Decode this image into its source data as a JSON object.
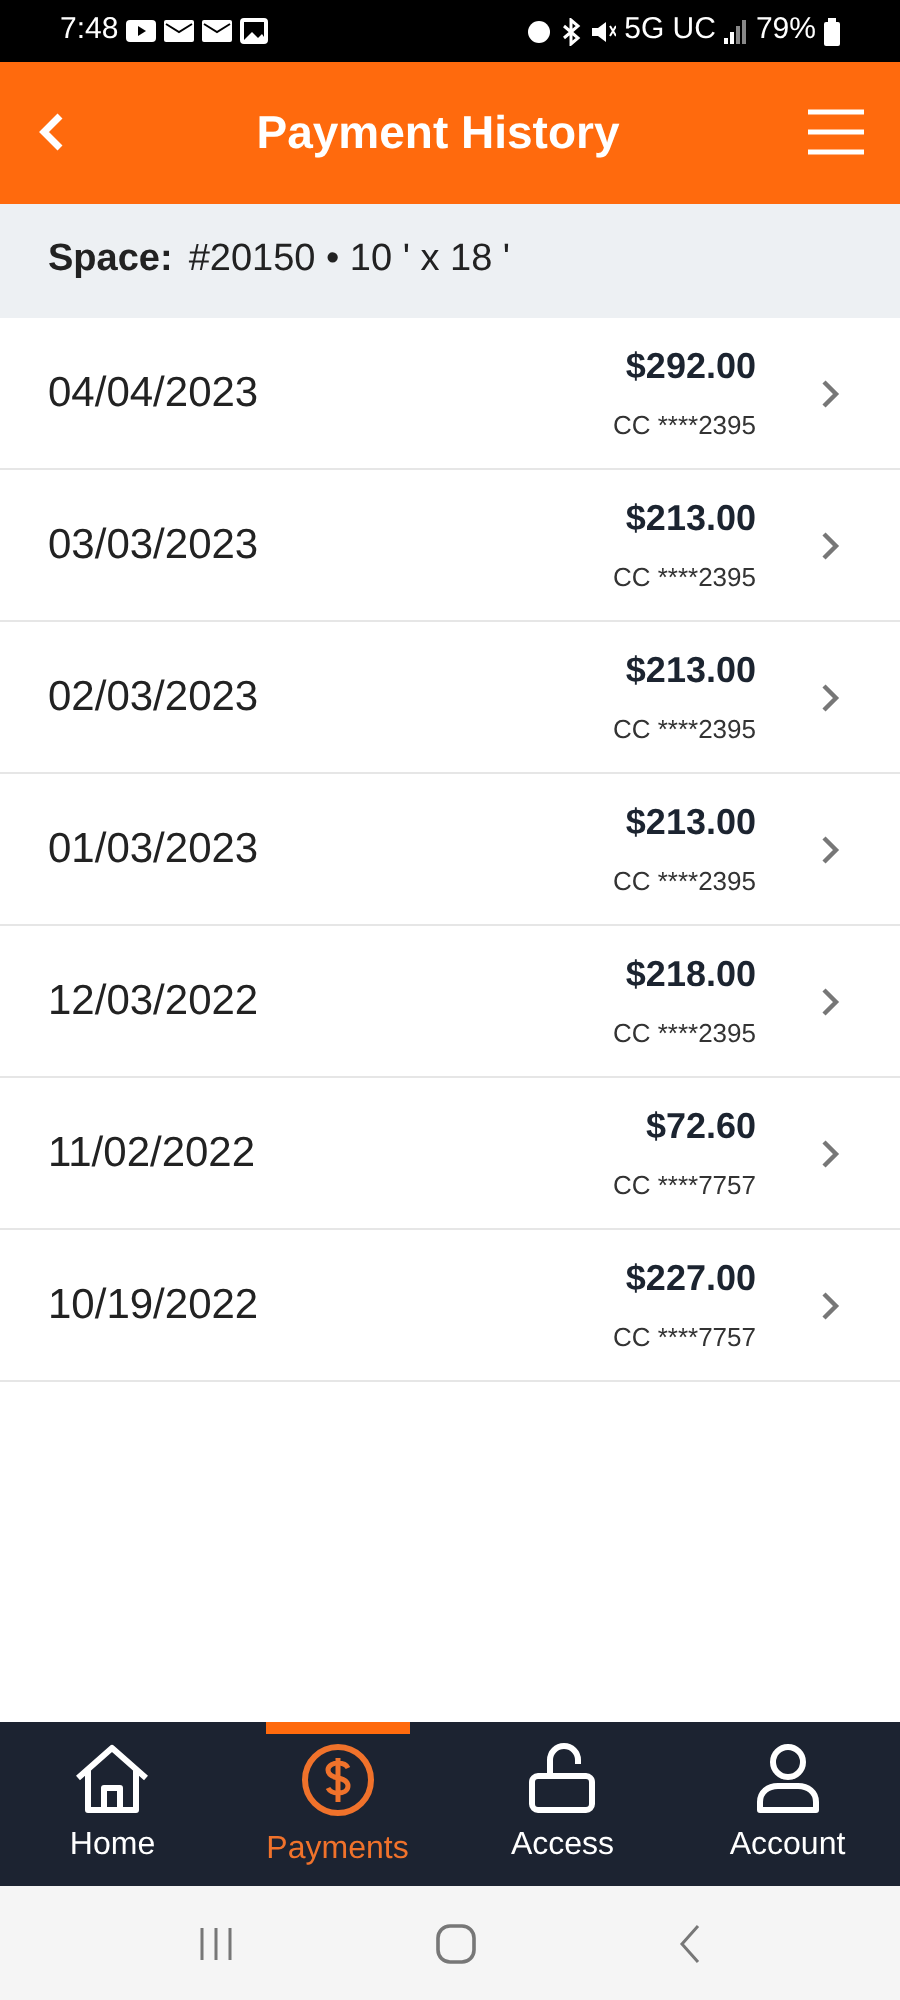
{
  "status_bar": {
    "time": "7:48",
    "network": "5G UC",
    "battery": "79%"
  },
  "header": {
    "title": "Payment History"
  },
  "space": {
    "label": "Space:",
    "value": "#20150 • 10 ' x 18 '"
  },
  "payments": [
    {
      "date": "04/04/2023",
      "amount": "$292.00",
      "method": "CC ****2395"
    },
    {
      "date": "03/03/2023",
      "amount": "$213.00",
      "method": "CC ****2395"
    },
    {
      "date": "02/03/2023",
      "amount": "$213.00",
      "method": "CC ****2395"
    },
    {
      "date": "01/03/2023",
      "amount": "$213.00",
      "method": "CC ****2395"
    },
    {
      "date": "12/03/2022",
      "amount": "$218.00",
      "method": "CC ****2395"
    },
    {
      "date": "11/02/2022",
      "amount": "$72.60",
      "method": "CC ****7757"
    },
    {
      "date": "10/19/2022",
      "amount": "$227.00",
      "method": "CC ****7757"
    }
  ],
  "tabs": [
    {
      "label": "Home",
      "kind": "home",
      "selected": false
    },
    {
      "label": "Payments",
      "kind": "payments",
      "selected": true
    },
    {
      "label": "Access",
      "kind": "access",
      "selected": false
    },
    {
      "label": "Account",
      "kind": "account",
      "selected": false
    }
  ]
}
